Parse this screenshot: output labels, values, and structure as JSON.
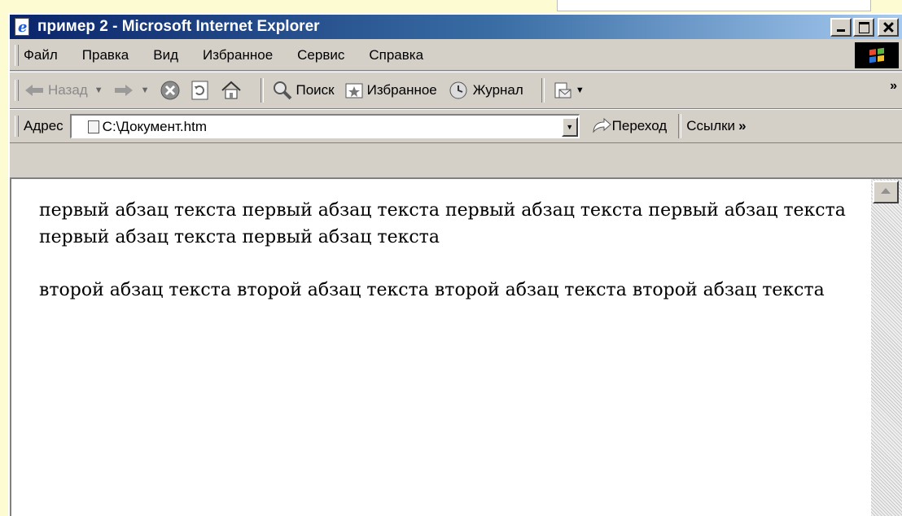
{
  "window": {
    "title": "пример 2 - Microsoft Internet Explorer"
  },
  "menu": {
    "file": "Файл",
    "edit": "Правка",
    "view": "Вид",
    "favorites": "Избранное",
    "tools": "Сервис",
    "help": "Справка"
  },
  "toolbar": {
    "back": "Назад",
    "search": "Поиск",
    "favorites": "Избранное",
    "history": "Журнал"
  },
  "address": {
    "label": "Адрес",
    "value": "C:\\Документ.htm",
    "go": "Переход",
    "links": "Ссылки"
  },
  "content": {
    "paragraph1": "первый абзац текста первый абзац текста первый абзац текста первый абзац текста первый абзац текста первый абзац текста",
    "paragraph2": "второй абзац текста второй абзац текста второй абзац текста второй абзац текста"
  },
  "icons": {
    "back": "back-arrow-icon",
    "forward": "forward-arrow-icon",
    "stop": "stop-icon",
    "refresh": "refresh-icon",
    "home": "home-icon",
    "search": "search-icon",
    "favorites": "favorites-icon",
    "history": "history-icon",
    "mail": "mail-icon",
    "go": "go-arrow-icon"
  },
  "colors": {
    "titlebar_start": "#0a246a",
    "titlebar_end": "#a6caf0",
    "chrome": "#d4d0c8",
    "page_background": "#fdfbd2"
  }
}
